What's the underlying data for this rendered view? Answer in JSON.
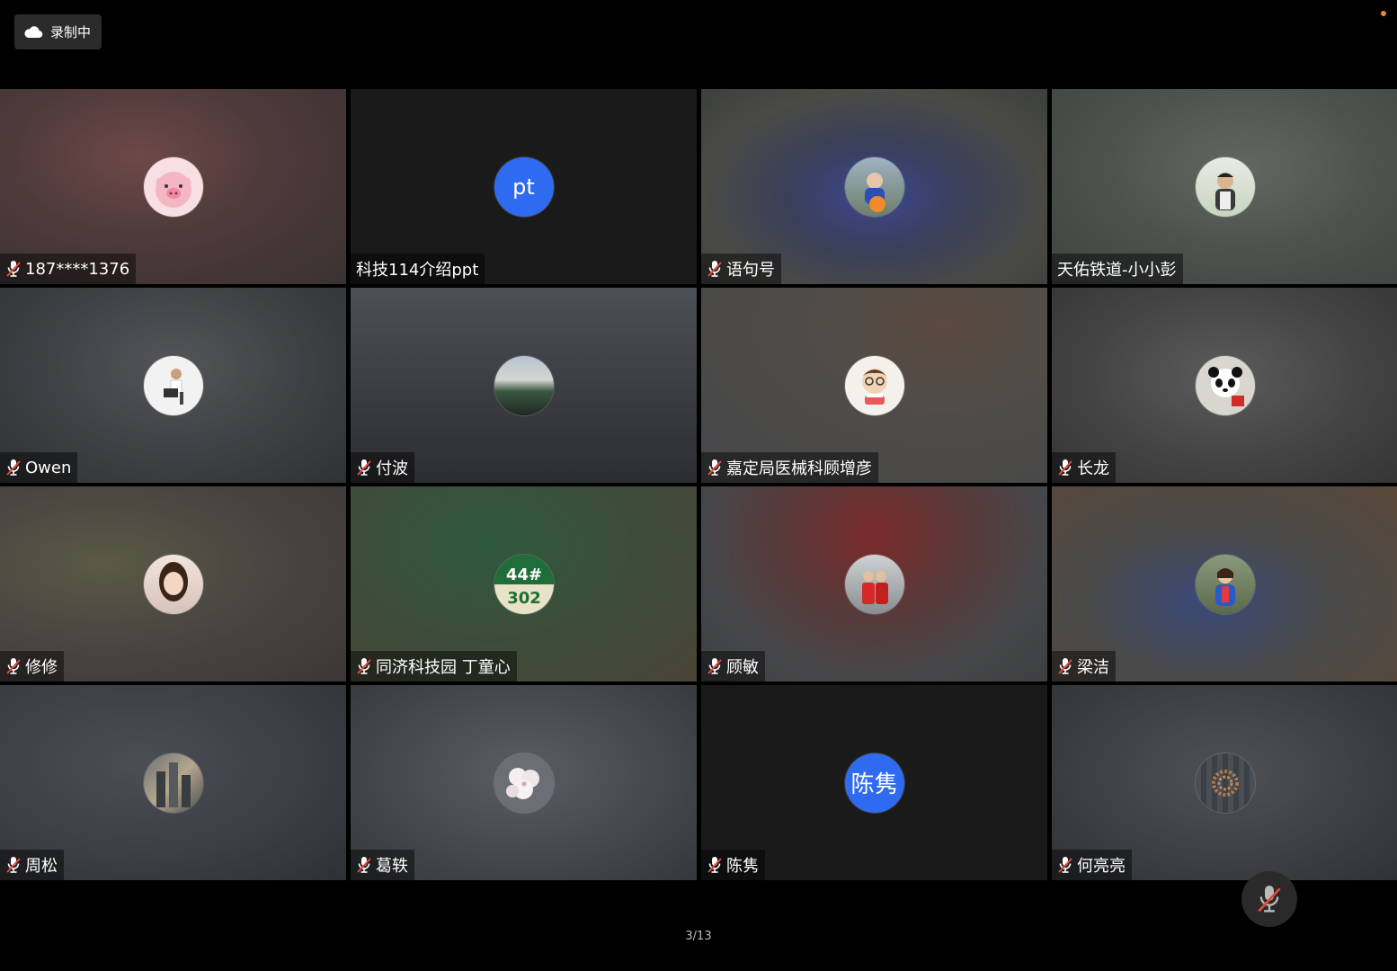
{
  "recording": {
    "label": "录制中",
    "icon": "cloud-icon"
  },
  "pager": {
    "label": "3/13"
  },
  "participants": [
    {
      "name": "187****1376",
      "muted": true,
      "avatar_text": "",
      "avatar_type": "pig-cartoon"
    },
    {
      "name": "科技114介绍ppt",
      "muted": false,
      "avatar_text": "pt",
      "avatar_type": "text"
    },
    {
      "name": "语句号",
      "muted": true,
      "avatar_text": "",
      "avatar_type": "child-photo"
    },
    {
      "name": "天佑铁道-小小彭",
      "muted": false,
      "avatar_text": "",
      "avatar_type": "person-photo"
    },
    {
      "name": "Owen",
      "muted": true,
      "avatar_text": "",
      "avatar_type": "person-photo"
    },
    {
      "name": "付波",
      "muted": true,
      "avatar_text": "",
      "avatar_type": "landscape-photo"
    },
    {
      "name": "嘉定局医械科顾增彦",
      "muted": true,
      "avatar_text": "",
      "avatar_type": "cartoon-man"
    },
    {
      "name": "长龙",
      "muted": true,
      "avatar_text": "",
      "avatar_type": "panda-photo"
    },
    {
      "name": "修修",
      "muted": true,
      "avatar_text": "",
      "avatar_type": "person-photo"
    },
    {
      "name": "同济科技园 丁童心",
      "muted": true,
      "avatar_text": "44#\n302",
      "avatar_type": "badge"
    },
    {
      "name": "顾敏",
      "muted": true,
      "avatar_text": "",
      "avatar_type": "people-photo"
    },
    {
      "name": "梁洁",
      "muted": true,
      "avatar_text": "",
      "avatar_type": "person-photo"
    },
    {
      "name": "周松",
      "muted": true,
      "avatar_text": "",
      "avatar_type": "city-photo"
    },
    {
      "name": "葛轶",
      "muted": true,
      "avatar_text": "",
      "avatar_type": "flower-photo"
    },
    {
      "name": "陈隽",
      "muted": true,
      "avatar_text": "陈隽",
      "avatar_type": "text"
    },
    {
      "name": "何亮亮",
      "muted": true,
      "avatar_text": "",
      "avatar_type": "beads-photo"
    }
  ],
  "colors": {
    "accent": "#2f6bf0",
    "background": "#000000",
    "mute_red": "#e5483b"
  }
}
